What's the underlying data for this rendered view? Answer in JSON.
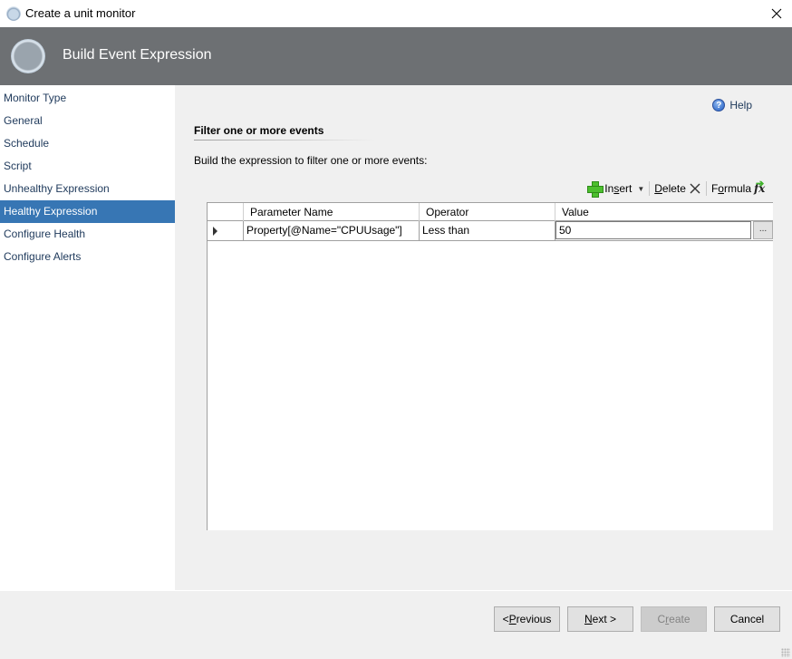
{
  "window": {
    "title": "Create a unit monitor",
    "close_icon": "close-icon"
  },
  "header": {
    "title": "Build Event Expression"
  },
  "sidebar": {
    "items": [
      {
        "label": "Monitor Type",
        "active": false
      },
      {
        "label": "General",
        "active": false
      },
      {
        "label": "Schedule",
        "active": false
      },
      {
        "label": "Script",
        "active": false
      },
      {
        "label": "Unhealthy Expression",
        "active": false
      },
      {
        "label": "Healthy Expression",
        "active": true
      },
      {
        "label": "Configure Health",
        "active": false
      },
      {
        "label": "Configure Alerts",
        "active": false
      }
    ]
  },
  "content": {
    "help_label": "Help",
    "section_title": "Filter one or more events",
    "description": "Build the expression to filter one or more events:",
    "toolbar": {
      "insert_label_pre": "In",
      "insert_label_mnemonic": "s",
      "insert_label_post": "ert",
      "delete_label_mnemonic": "D",
      "delete_label_post": "elete",
      "formula_label_pre": "F",
      "formula_label_mnemonic": "o",
      "formula_label_post": "rmula"
    },
    "grid": {
      "columns": [
        "Parameter Name",
        "Operator",
        "Value"
      ],
      "rows": [
        {
          "parameter_name": "Property[@Name=\"CPUUsage\"]",
          "operator": "Less than",
          "value": "50",
          "ellipsis": "..."
        }
      ]
    }
  },
  "footer": {
    "previous": {
      "pre": "< ",
      "mnemonic": "P",
      "post": "revious"
    },
    "next": {
      "mnemonic": "N",
      "post": "ext >"
    },
    "create": {
      "pre": "C",
      "mnemonic": "r",
      "post": "eate",
      "disabled": true
    },
    "cancel": "Cancel"
  },
  "colors": {
    "header_bg": "#6d7073",
    "active_nav_bg": "#3776b4",
    "nav_text": "#1e395b"
  }
}
